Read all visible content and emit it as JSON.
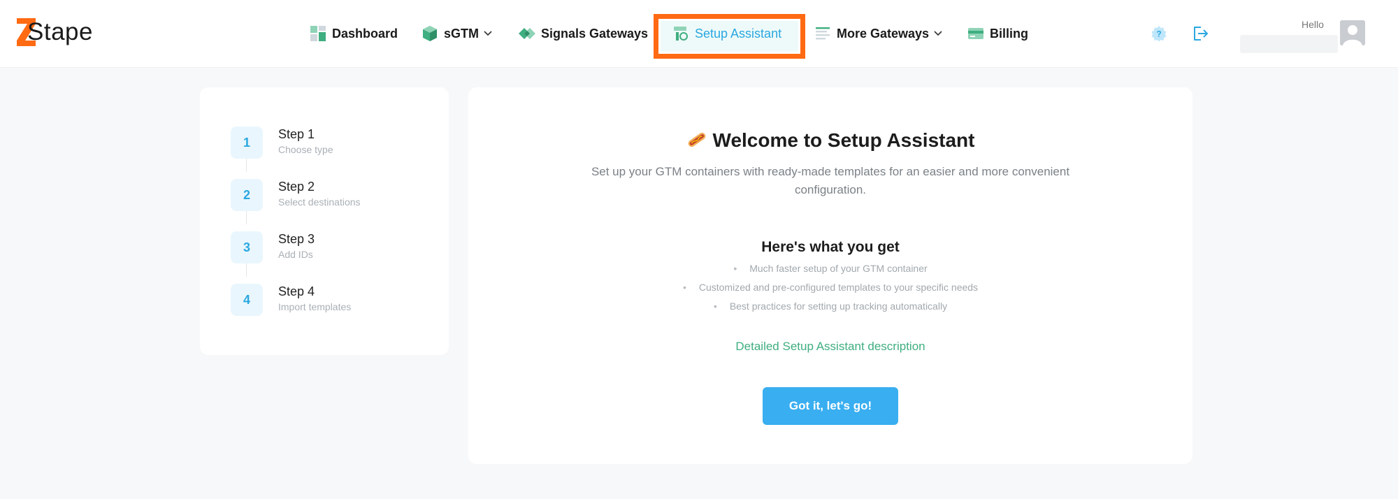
{
  "brand": {
    "logo_text": "Stape",
    "accent": "#ff6a13",
    "primary": "#39aef0",
    "link": "#3fae80"
  },
  "nav": {
    "items": [
      {
        "label": "Dashboard",
        "icon": "dashboard-icon"
      },
      {
        "label": "sGTM",
        "icon": "cube-icon",
        "has_dropdown": true
      },
      {
        "label": "Signals Gateways",
        "icon": "signals-icon"
      },
      {
        "label": "Setup Assistant",
        "icon": "setup-assistant-icon",
        "active": true
      },
      {
        "label": "More Gateways",
        "icon": "list-icon",
        "has_dropdown": true
      },
      {
        "label": "Billing",
        "icon": "credit-card-icon"
      }
    ]
  },
  "user": {
    "greeting": "Hello",
    "icons": [
      "help-icon",
      "logout-icon",
      "avatar-icon"
    ]
  },
  "steps": [
    {
      "number": "1",
      "title": "Step 1",
      "subtitle": "Choose type"
    },
    {
      "number": "2",
      "title": "Step 2",
      "subtitle": "Select destinations"
    },
    {
      "number": "3",
      "title": "Step 3",
      "subtitle": "Add IDs"
    },
    {
      "number": "4",
      "title": "Step 4",
      "subtitle": "Import templates"
    }
  ],
  "main": {
    "title": "Welcome to Setup Assistant",
    "title_icon": "hotdog-icon",
    "intro": "Set up your GTM containers with ready-made templates for an easier and more convenient configuration.",
    "benefits_title": "Here's what you get",
    "benefits": [
      "Much faster setup of your GTM container",
      "Customized and pre-configured templates to your specific needs",
      "Best practices for setting up tracking automatically"
    ],
    "link_label": "Detailed Setup Assistant description",
    "cta_label": "Got it, let's go!"
  }
}
